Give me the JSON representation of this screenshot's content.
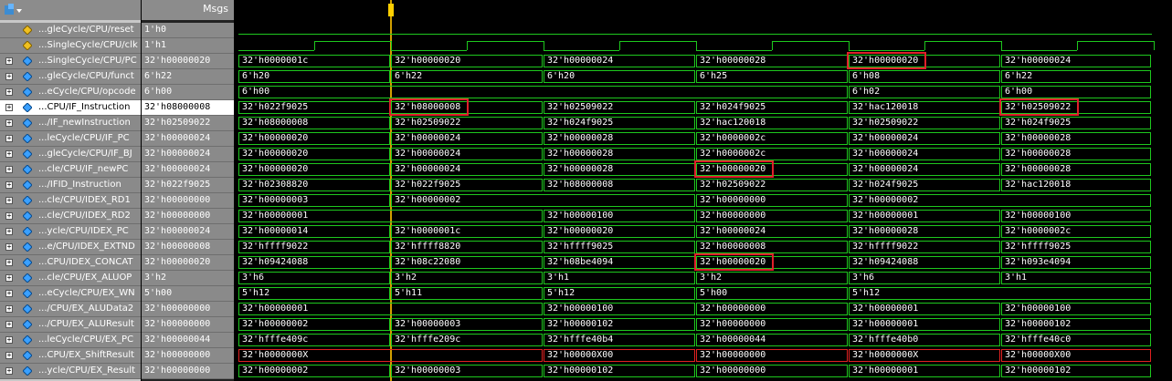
{
  "header": {
    "msgs_label": "Msgs"
  },
  "signals": [
    {
      "name": "...gleCycle/CPU/reset",
      "value": "1'h0",
      "kind": "bit",
      "icon": "signal-icon",
      "expand": false
    },
    {
      "name": "...SingleCycle/CPU/clk",
      "value": "1'h1",
      "kind": "clock",
      "icon": "signal-icon",
      "expand": false
    },
    {
      "name": "...SingleCycle/CPU/PC",
      "value": "32'h00000020",
      "kind": "bus",
      "icon": "bus-icon",
      "expand": true,
      "cells": [
        "32'h0000001c",
        "32'h00000020",
        "32'h00000024",
        "32'h00000028",
        "32'h00000020",
        "32'h00000024"
      ]
    },
    {
      "name": "...gleCycle/CPU/funct",
      "value": "6'h22",
      "kind": "bus",
      "icon": "bus-icon",
      "expand": true,
      "cells": [
        "6'h20",
        "6'h22",
        "6'h20",
        "6'h25",
        "6'h08",
        "6'h22"
      ]
    },
    {
      "name": "...eCycle/CPU/opcode",
      "value": "6'h00",
      "kind": "bus",
      "icon": "bus-icon",
      "expand": true,
      "cells": [
        "6'h00",
        "",
        "",
        "",
        "6'h02",
        "6'h00"
      ]
    },
    {
      "name": "...CPU/IF_Instruction",
      "value": "32'h08000008",
      "kind": "bus",
      "icon": "bus-icon",
      "expand": true,
      "selected": true,
      "cells": [
        "32'h022f9025",
        "32'h08000008",
        "32'h02509022",
        "32'h024f9025",
        "32'hac120018",
        "32'h02509022"
      ]
    },
    {
      "name": ".../IF_newInstruction",
      "value": "32'h02509022",
      "kind": "bus",
      "icon": "bus-icon",
      "expand": true,
      "cells": [
        "32'h08000008",
        "32'h02509022",
        "32'h024f9025",
        "32'hac120018",
        "32'h02509022",
        "32'h024f9025"
      ]
    },
    {
      "name": "...leCycle/CPU/IF_PC",
      "value": "32'h00000024",
      "kind": "bus",
      "icon": "bus-icon",
      "expand": true,
      "cells": [
        "32'h00000020",
        "32'h00000024",
        "32'h00000028",
        "32'h0000002c",
        "32'h00000024",
        "32'h00000028"
      ]
    },
    {
      "name": "...gleCycle/CPU/IF_BJ",
      "value": "32'h00000024",
      "kind": "bus",
      "icon": "bus-icon",
      "expand": true,
      "cells": [
        "32'h00000020",
        "32'h00000024",
        "32'h00000028",
        "32'h0000002c",
        "32'h00000024",
        "32'h00000028"
      ]
    },
    {
      "name": "...cle/CPU/IF_newPC",
      "value": "32'h00000024",
      "kind": "bus",
      "icon": "bus-icon",
      "expand": true,
      "cells": [
        "32'h00000020",
        "32'h00000024",
        "32'h00000028",
        "32'h00000020",
        "32'h00000024",
        "32'h00000028"
      ]
    },
    {
      "name": ".../IFID_Instruction",
      "value": "32'h022f9025",
      "kind": "bus",
      "icon": "bus-icon",
      "expand": true,
      "cells": [
        "32'h02308820",
        "32'h022f9025",
        "32'h08000008",
        "32'h02509022",
        "32'h024f9025",
        "32'hac120018"
      ]
    },
    {
      "name": "...cle/CPU/IDEX_RD1",
      "value": "32'h00000000",
      "kind": "bus",
      "icon": "bus-icon",
      "expand": true,
      "cells": [
        "32'h00000003",
        "32'h00000002",
        "",
        "32'h00000000",
        "32'h00000002",
        ""
      ]
    },
    {
      "name": "...cle/CPU/IDEX_RD2",
      "value": "32'h00000000",
      "kind": "bus",
      "icon": "bus-icon",
      "expand": true,
      "cells": [
        "32'h00000001",
        "",
        "32'h00000100",
        "32'h00000000",
        "32'h00000001",
        "32'h00000100"
      ]
    },
    {
      "name": "...ycle/CPU/IDEX_PC",
      "value": "32'h00000024",
      "kind": "bus",
      "icon": "bus-icon",
      "expand": true,
      "cells": [
        "32'h00000014",
        "32'h0000001c",
        "32'h00000020",
        "32'h00000024",
        "32'h00000028",
        "32'h0000002c"
      ]
    },
    {
      "name": "...e/CPU/IDEX_EXTND",
      "value": "32'h00000008",
      "kind": "bus",
      "icon": "bus-icon",
      "expand": true,
      "cells": [
        "32'hffff9022",
        "32'hffff8820",
        "32'hffff9025",
        "32'h00000008",
        "32'hffff9022",
        "32'hffff9025"
      ]
    },
    {
      "name": "...CPU/IDEX_CONCAT",
      "value": "32'h00000020",
      "kind": "bus",
      "icon": "bus-icon",
      "expand": true,
      "cells": [
        "32'h09424088",
        "32'h08c22080",
        "32'h08be4094",
        "32'h00000020",
        "32'h09424088",
        "32'h093e4094"
      ]
    },
    {
      "name": "...cle/CPU/EX_ALUOP",
      "value": "3'h2",
      "kind": "bus",
      "icon": "bus-icon",
      "expand": true,
      "cells": [
        "3'h6",
        "3'h2",
        "3'h1",
        "3'h2",
        "3'h6",
        "3'h1"
      ]
    },
    {
      "name": "...eCycle/CPU/EX_WN",
      "value": "5'h00",
      "kind": "bus",
      "icon": "bus-icon",
      "expand": true,
      "cells": [
        "5'h12",
        "5'h11",
        "5'h12",
        "5'h00",
        "5'h12",
        ""
      ]
    },
    {
      "name": ".../CPU/EX_ALUData2",
      "value": "32'h00000000",
      "kind": "bus",
      "icon": "bus-icon",
      "expand": true,
      "cells": [
        "32'h00000001",
        "",
        "32'h00000100",
        "32'h00000000",
        "32'h00000001",
        "32'h00000100"
      ]
    },
    {
      "name": ".../CPU/EX_ALUResult",
      "value": "32'h00000000",
      "kind": "bus",
      "icon": "bus-icon",
      "expand": true,
      "cells": [
        "32'h00000002",
        "32'h00000003",
        "32'h00000102",
        "32'h00000000",
        "32'h00000001",
        "32'h00000102"
      ]
    },
    {
      "name": "...leCycle/CPU/EX_PC",
      "value": "32'h00000044",
      "kind": "bus",
      "icon": "bus-icon",
      "expand": true,
      "cells": [
        "32'hfffe409c",
        "32'hfffe209c",
        "32'hfffe40b4",
        "32'h00000044",
        "32'hfffe40b0",
        "32'hfffe40c0"
      ]
    },
    {
      "name": "...CPU/EX_ShiftResult",
      "value": "32'h00000000",
      "kind": "bus",
      "icon": "bus-icon",
      "expand": true,
      "xrow": true,
      "cells": [
        "32'h0000000X",
        "",
        "32'h00000X00",
        "32'h00000000",
        "32'h0000000X",
        "32'h00000X00"
      ]
    },
    {
      "name": "...ycle/CPU/EX_Result",
      "value": "32'h00000000",
      "kind": "bus",
      "icon": "bus-icon",
      "expand": true,
      "cells": [
        "32'h00000002",
        "32'h00000003",
        "32'h00000102",
        "32'h00000000",
        "32'h00000001",
        "32'h00000102"
      ]
    }
  ],
  "highlights": [
    {
      "row": 2,
      "seg": 4
    },
    {
      "row": 5,
      "seg": 1
    },
    {
      "row": 5,
      "seg": 5
    },
    {
      "row": 9,
      "seg": 3
    },
    {
      "row": 15,
      "seg": 3
    }
  ],
  "colors": {
    "wave": "#1ec81e",
    "cursor": "#ffcf00",
    "highlight": "#e0202a",
    "unknown": "#e02020"
  }
}
